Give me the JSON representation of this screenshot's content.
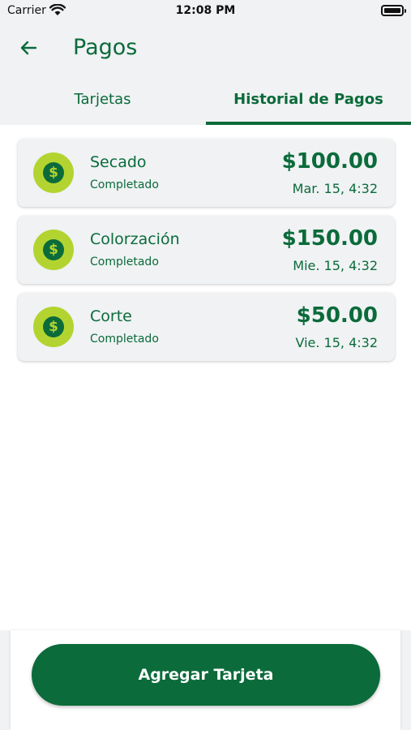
{
  "status_bar": {
    "carrier": "Carrier",
    "time": "12:08 PM"
  },
  "header": {
    "title": "Pagos",
    "back_icon": "arrow-left-icon"
  },
  "tabs": [
    {
      "label": "Tarjetas",
      "active": false
    },
    {
      "label": "Historial de Pagos",
      "active": true
    }
  ],
  "payments": [
    {
      "name": "Secado",
      "status": "Completado",
      "amount": "$100.00",
      "date": "Mar. 15, 4:32",
      "icon": "dollar-coin-icon"
    },
    {
      "name": "Colorzación",
      "status": "Completado",
      "amount": "$150.00",
      "date": "Mie. 15, 4:32",
      "icon": "dollar-coin-icon"
    },
    {
      "name": "Corte",
      "status": "Completado",
      "amount": "$50.00",
      "date": "Vie. 15, 4:32",
      "icon": "dollar-coin-icon"
    }
  ],
  "footer": {
    "add_card_label": "Agregar Tarjeta"
  },
  "colors": {
    "primary": "#0b6b3a",
    "accent": "#b3d430",
    "surface": "#f0f2f4"
  }
}
